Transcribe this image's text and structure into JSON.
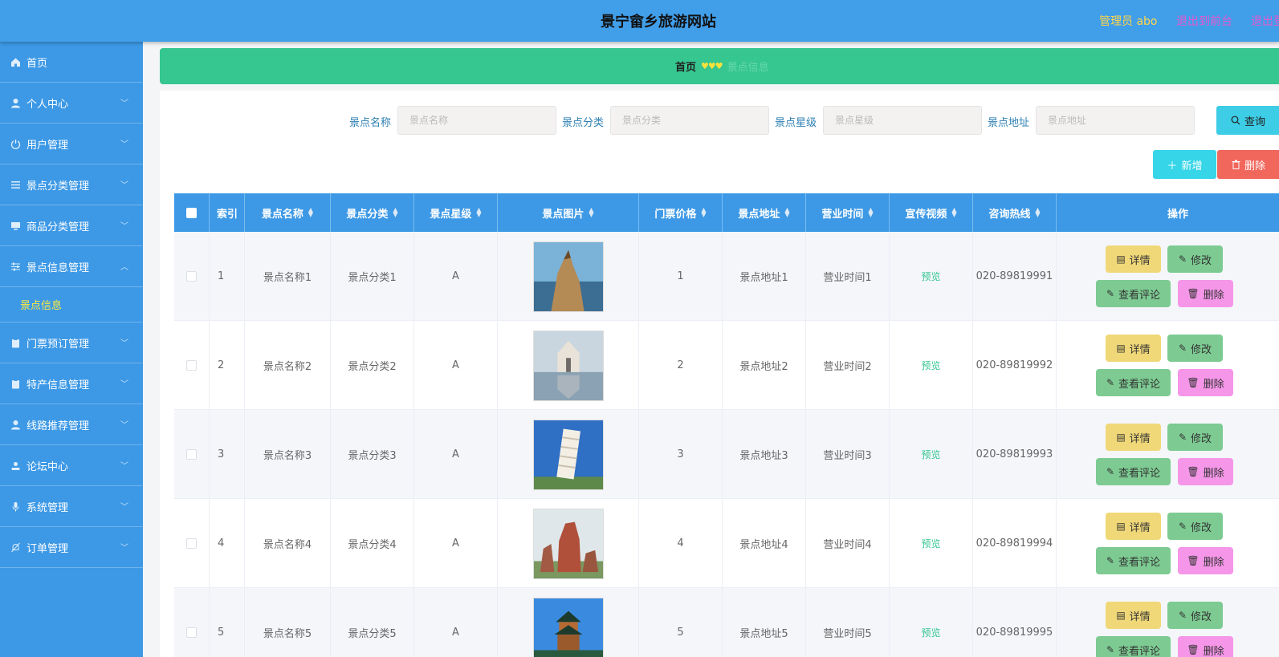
{
  "header": {
    "title": "景宁畲乡旅游网站",
    "admin": "管理员 abo",
    "exit_front": "退出到前台",
    "exit_login": "退出登录"
  },
  "sidebar": {
    "items": [
      {
        "label": "首页",
        "icon": "home-icon",
        "expandable": false
      },
      {
        "label": "个人中心",
        "icon": "user-icon",
        "expandable": true
      },
      {
        "label": "用户管理",
        "icon": "power-icon",
        "expandable": true
      },
      {
        "label": "景点分类管理",
        "icon": "list-icon",
        "expandable": true
      },
      {
        "label": "商品分类管理",
        "icon": "monitor-icon",
        "expandable": true
      },
      {
        "label": "景点信息管理",
        "icon": "sliders-icon",
        "expandable": true,
        "open": true
      },
      {
        "label": "门票预订管理",
        "icon": "clipboard-icon",
        "expandable": true
      },
      {
        "label": "特产信息管理",
        "icon": "clipboard-icon",
        "expandable": true
      },
      {
        "label": "线路推荐管理",
        "icon": "user-icon",
        "expandable": true
      },
      {
        "label": "论坛中心",
        "icon": "person-icon",
        "expandable": true
      },
      {
        "label": "系统管理",
        "icon": "mic-icon",
        "expandable": true
      },
      {
        "label": "订单管理",
        "icon": "bell-off-icon",
        "expandable": true
      }
    ],
    "sub_item": "景点信息"
  },
  "breadcrumb": {
    "home": "首页",
    "separator": "♥♥♥",
    "current": "景点信息"
  },
  "search": {
    "fields": [
      {
        "label": "景点名称",
        "placeholder": "景点名称"
      },
      {
        "label": "景点分类",
        "placeholder": "景点分类"
      },
      {
        "label": "景点星级",
        "placeholder": "景点星级"
      },
      {
        "label": "景点地址",
        "placeholder": "景点地址"
      }
    ],
    "query_label": "查询"
  },
  "actions": {
    "add_label": "新增",
    "delete_label": "删除"
  },
  "table": {
    "headers": [
      "索引",
      "景点名称",
      "景点分类",
      "景点星级",
      "景点图片",
      "门票价格",
      "景点地址",
      "营业时间",
      "宣传视频",
      "咨询热线",
      "操作"
    ],
    "rows": [
      {
        "index": "1",
        "name": "景点名称1",
        "category": "景点分类1",
        "star": "A",
        "price": "1",
        "address": "景点地址1",
        "hours": "营业时间1",
        "video": "预览",
        "hotline": "020-89819991"
      },
      {
        "index": "2",
        "name": "景点名称2",
        "category": "景点分类2",
        "star": "A",
        "price": "2",
        "address": "景点地址2",
        "hours": "营业时间2",
        "video": "预览",
        "hotline": "020-89819992"
      },
      {
        "index": "3",
        "name": "景点名称3",
        "category": "景点分类3",
        "star": "A",
        "price": "3",
        "address": "景点地址3",
        "hours": "营业时间3",
        "video": "预览",
        "hotline": "020-89819993"
      },
      {
        "index": "4",
        "name": "景点名称4",
        "category": "景点分类4",
        "star": "A",
        "price": "4",
        "address": "景点地址4",
        "hours": "营业时间4",
        "video": "预览",
        "hotline": "020-89819994"
      },
      {
        "index": "5",
        "name": "景点名称5",
        "category": "景点分类5",
        "star": "A",
        "price": "5",
        "address": "景点地址5",
        "hours": "营业时间5",
        "video": "预览",
        "hotline": "020-89819995"
      }
    ],
    "op_labels": {
      "detail": "详情",
      "edit": "修改",
      "review": "查看评论",
      "remove": "删除"
    }
  },
  "colors": {
    "header_bg": "#419ee9",
    "sidebar_bg": "#3d99e6",
    "breadcrumb_bg": "#36c690",
    "detail_btn": "#f0d878",
    "edit_btn": "#7dcb92",
    "remove_btn": "#f596e8"
  }
}
